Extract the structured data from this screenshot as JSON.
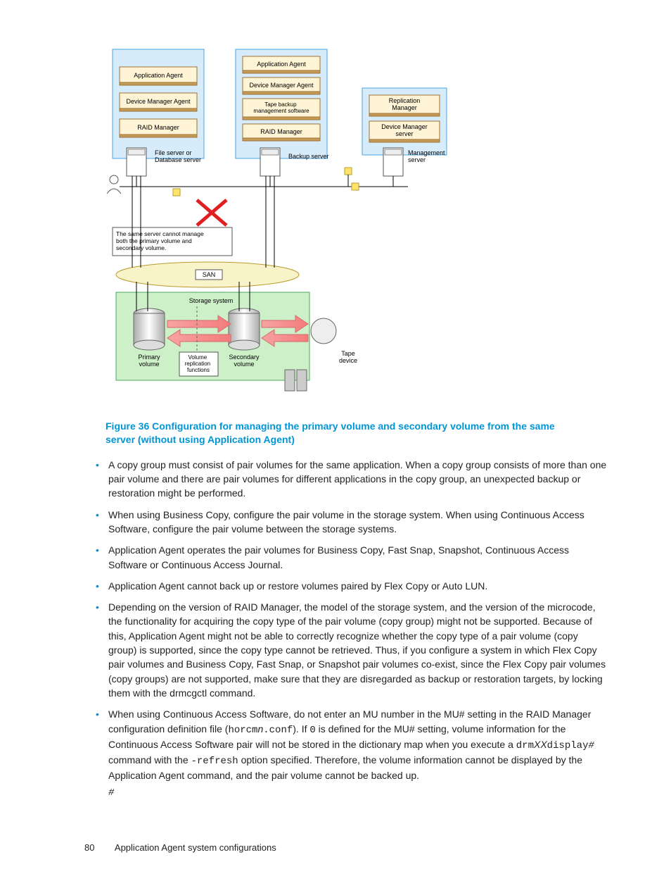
{
  "diagram": {
    "boxA": {
      "labels": [
        "Application Agent",
        "Device Manager Agent",
        "RAID Manager"
      ],
      "server": "File server or\nDatabase server"
    },
    "boxB": {
      "labels": [
        "Application Agent",
        "Device Manager Agent",
        "Tape backup\nmanagement software",
        "RAID Manager"
      ],
      "server": "Backup server"
    },
    "boxC": {
      "labels": [
        "Replication\nManager",
        "Device Manager\nserver"
      ],
      "server": "Management\nserver"
    },
    "note": "The same server cannot manage\nboth the primary volume and\nsecondary volume.",
    "san": "SAN",
    "storage": "Storage system",
    "pvol": "Primary\nvolume",
    "repfunc": "Volume\nreplication\nfunctions",
    "svol": "Secondary\nvolume",
    "tape": "Tape\ndevice"
  },
  "caption": "Figure 36 Configuration for managing the primary volume and secondary volume from the same server (without using Application Agent)",
  "bullets": [
    {
      "text": "A copy group must consist of pair volumes for the same application. When a copy group consists of more than one pair volume and there are pair volumes for different applications in the copy group, an unexpected backup or restoration might be performed."
    },
    {
      "text": "When using Business Copy, configure the pair volume in the storage system. When using Continuous Access Software, configure the pair volume between the storage systems."
    },
    {
      "text": "Application Agent operates the pair volumes for Business Copy, Fast Snap, Snapshot, Continuous Access Software or Continuous Access Journal."
    },
    {
      "text": "Application Agent cannot back up or restore volumes paired by Flex Copy or Auto LUN."
    },
    {
      "text": "Depending on the version of RAID Manager, the model of the storage system, and the version of the microcode, the functionality for acquiring the copy type of the pair volume (copy group) might not be supported. Because of this, Application Agent might not be able to correctly recognize whether the copy type of a pair volume (copy group) is supported, since the copy type cannot be retrieved. Thus, if you configure a system in which Flex Copy pair volumes and Business Copy, Fast Snap, or Snapshot pair volumes co-exist, since the Flex Copy pair volumes (copy groups) are not supported, make sure that they are disregarded as backup or restoration targets, by locking them with the drmcgctl command."
    }
  ],
  "bullet6": {
    "pre_a": "When using Continuous Access Software, do not enter an MU number in the MU# setting in the RAID Manager configuration definition file (",
    "horcm_n_conf_inner": "n",
    "post_a": "). If ",
    "zero": "0",
    "post_a2": " is defined for the MU# setting, volume information for the Continuous Access Software pair will not be stored in the dictionary map when you execute a ",
    "drm_pre": "drm",
    "drm_xx": "XX",
    "drm_post": "display",
    "sharp": "#",
    "cmd_with": " command with the ",
    "refresh": "-refresh",
    "opt_spec": " option specified. Therefore, the volume information cannot be displayed by the Application Agent command, and the pair volume cannot be backed up.",
    "sharp_line": "#"
  },
  "footer": {
    "page": "80",
    "title": "Application Agent system configurations"
  }
}
